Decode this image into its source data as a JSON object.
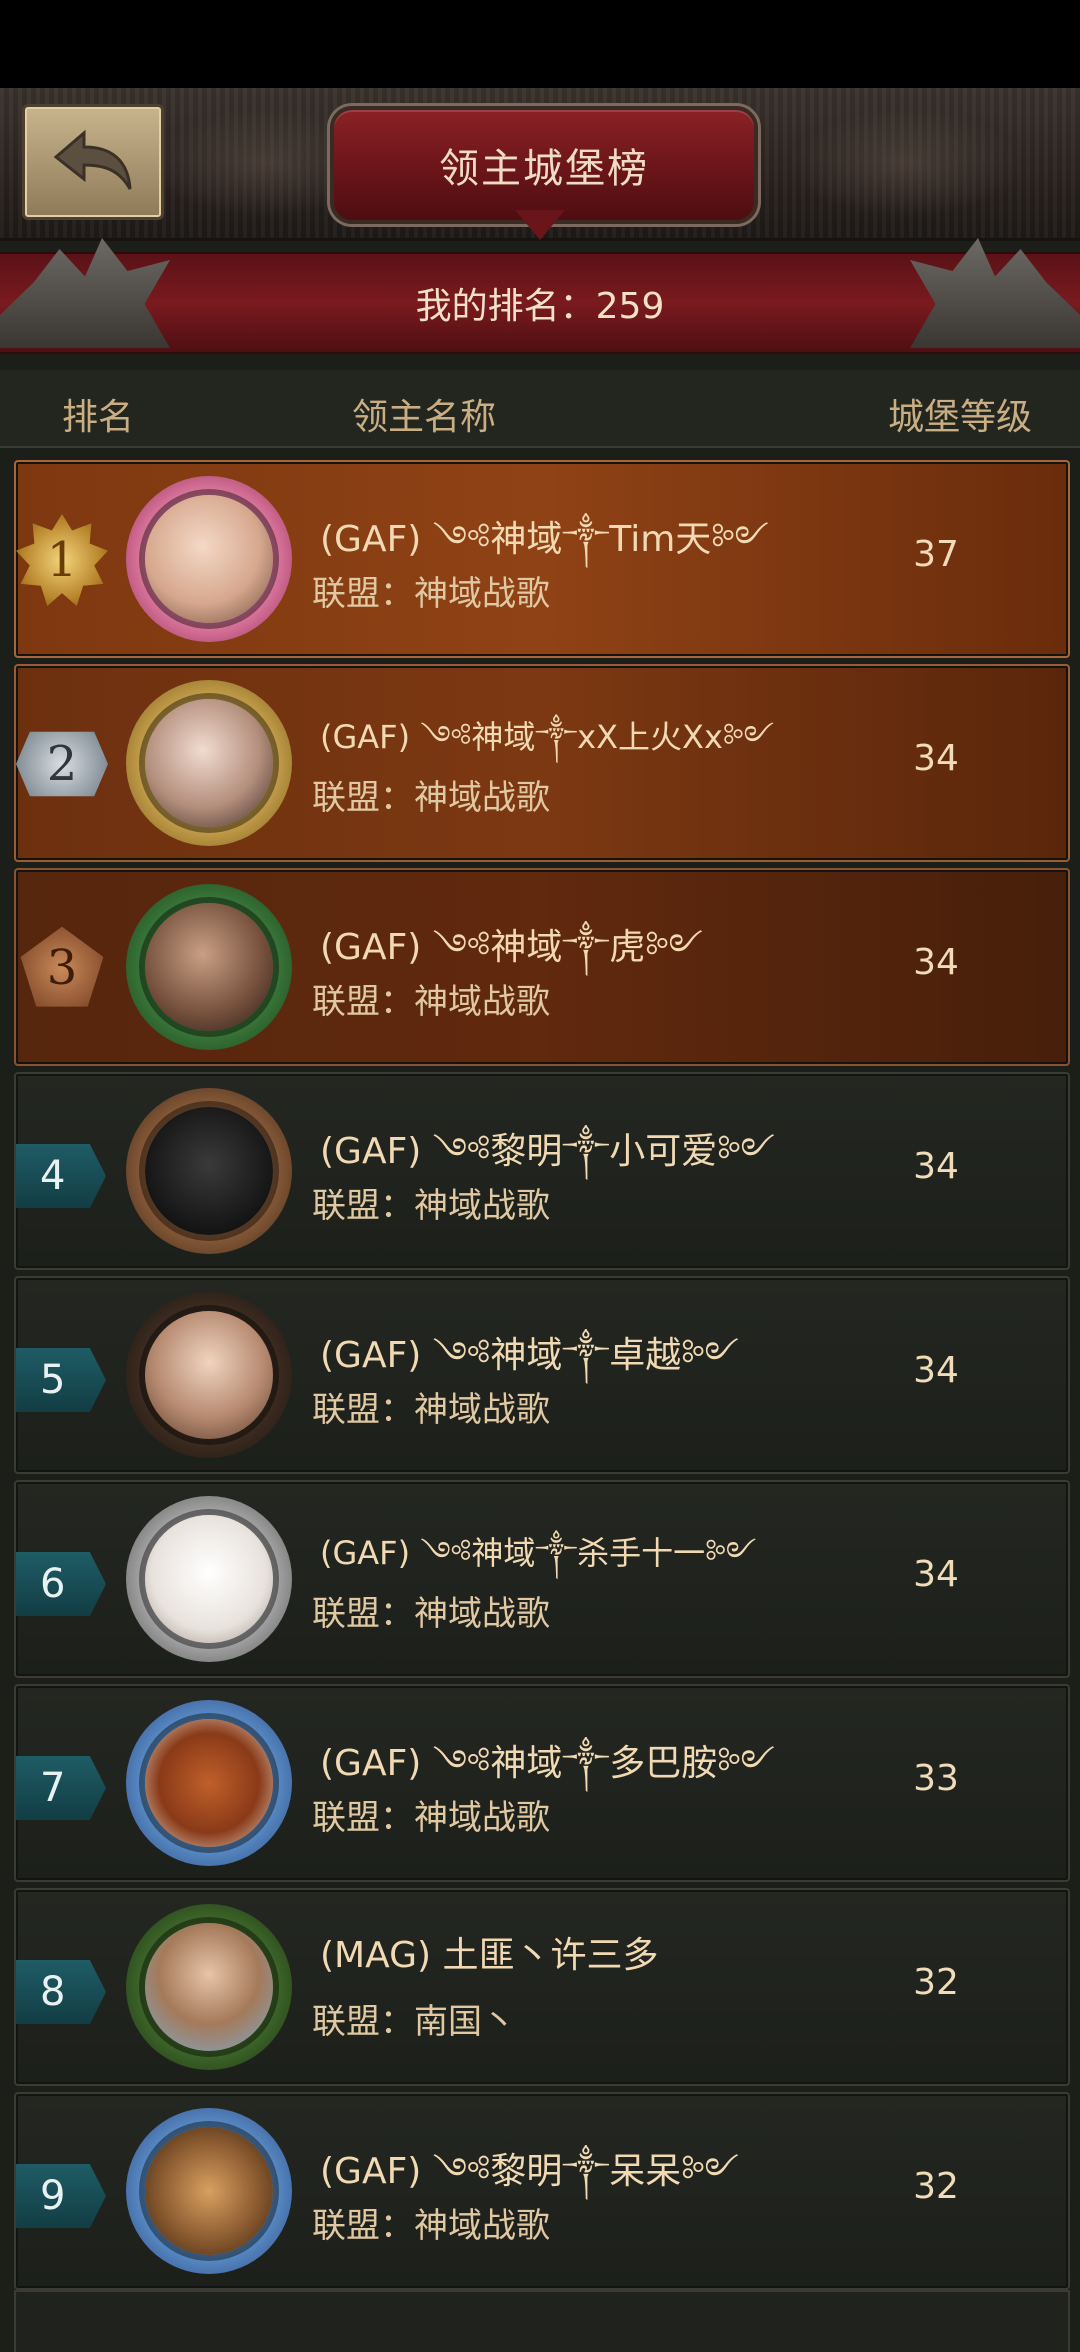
{
  "header": {
    "title": "领主城堡榜",
    "my_rank": "我的排名：259"
  },
  "columns": {
    "rank": "排名",
    "lord_name": "领主名称",
    "castle_level": "城堡等级"
  },
  "rows": [
    {
      "rank": "1",
      "name": "(GAF) ༺神域༒Tim天༻",
      "alliance": "联盟：神域战歌",
      "level": "37"
    },
    {
      "rank": "2",
      "name": "(GAF) ༺神域༒xX上火Xx༻",
      "alliance": "联盟：神域战歌",
      "level": "34"
    },
    {
      "rank": "3",
      "name": "(GAF) ༺神域༒虎༻",
      "alliance": "联盟：神域战歌",
      "level": "34"
    },
    {
      "rank": "4",
      "name": "(GAF) ༺黎明༒小可爱༻",
      "alliance": "联盟：神域战歌",
      "level": "34"
    },
    {
      "rank": "5",
      "name": "(GAF) ༺神域༒卓越༻",
      "alliance": "联盟：神域战歌",
      "level": "34"
    },
    {
      "rank": "6",
      "name": "(GAF) ༺神域༒杀手十一༻",
      "alliance": "联盟：神域战歌",
      "level": "34"
    },
    {
      "rank": "7",
      "name": "(GAF) ༺神域༒多巴胺༻",
      "alliance": "联盟：神域战歌",
      "level": "33"
    },
    {
      "rank": "8",
      "name": "(MAG) 土匪丶许三多",
      "alliance": "联盟：南国丶",
      "level": "32"
    },
    {
      "rank": "9",
      "name": "(GAF) ༺黎明༒呆呆༻",
      "alliance": "联盟：神域战歌",
      "level": "32"
    }
  ],
  "icons": {
    "back": "back-arrow-icon"
  }
}
